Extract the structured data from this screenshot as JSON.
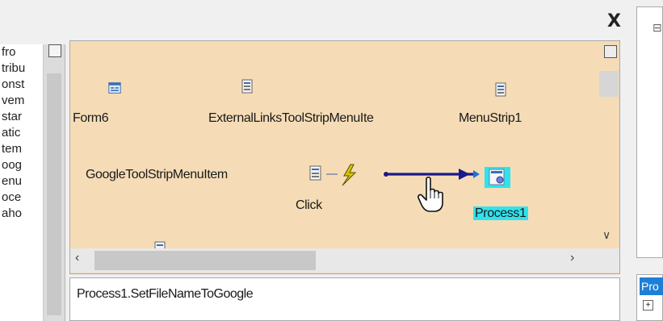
{
  "window": {
    "close_glyph": "X"
  },
  "left_panel": {
    "items": [
      "fro",
      "tribu",
      "onst",
      "vem",
      "star",
      "atic",
      "tem",
      "oog",
      "enu",
      "oce",
      "aho"
    ]
  },
  "designer": {
    "components": [
      {
        "name": "Form6",
        "icon": "form-icon"
      },
      {
        "name": "ExternalLinksToolStripMenuIte",
        "icon": "component-icon"
      },
      {
        "name": "MenuStrip1",
        "icon": "component-icon"
      },
      {
        "name": "GoogleToolStripMenuItem",
        "icon": "component-icon"
      },
      {
        "name": "Process1",
        "icon": "process-icon",
        "selected": true
      }
    ],
    "event_label": "Click",
    "colors": {
      "canvas": "#f5dcb6",
      "selection": "#2fe3ee",
      "wire": "#1a1a8c"
    }
  },
  "code": {
    "text": "Process1.SetFileNameToGoogle"
  },
  "right_panel": {
    "header_text": "Pro"
  }
}
